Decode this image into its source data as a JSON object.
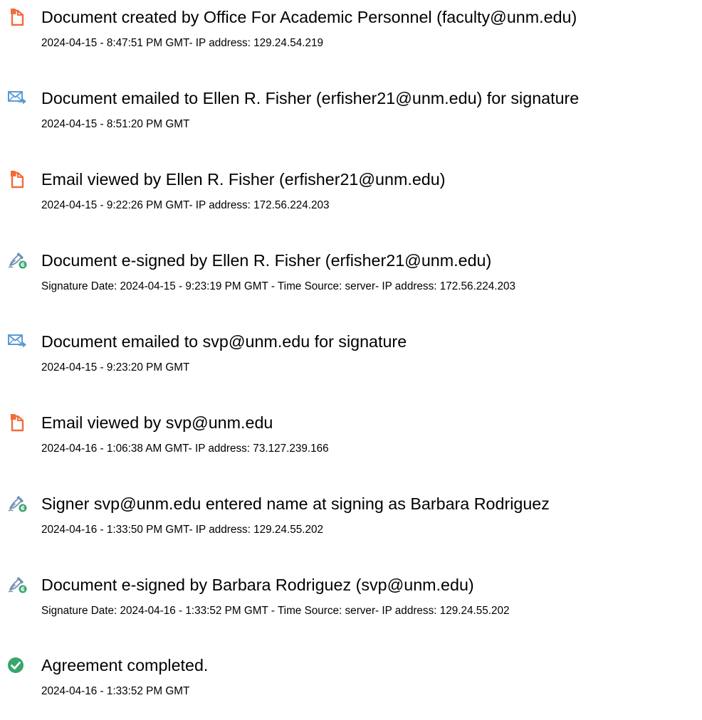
{
  "colors": {
    "document_icon": "#f26b3a",
    "email_icon": "#5a9bd5",
    "signature_icon": "#6f8fb3",
    "signature_badge": "#39a56c",
    "completed_badge": "#39a56c"
  },
  "events": [
    {
      "icon": "document-icon",
      "title": "Document created by Office For Academic Personnel (faculty@unm.edu)",
      "detail": "2024-04-15 - 8:47:51 PM GMT- IP address: 129.24.54.219"
    },
    {
      "icon": "email-icon",
      "title": "Document emailed to Ellen R. Fisher (erfisher21@unm.edu) for signature",
      "detail": "2024-04-15 - 8:51:20 PM GMT"
    },
    {
      "icon": "document-icon",
      "title": "Email viewed by Ellen R. Fisher (erfisher21@unm.edu)",
      "detail": "2024-04-15 - 9:22:26 PM GMT- IP address: 172.56.224.203"
    },
    {
      "icon": "signature-icon",
      "title": "Document e-signed by Ellen R. Fisher (erfisher21@unm.edu)",
      "detail": "Signature Date: 2024-04-15 - 9:23:19 PM GMT - Time Source: server- IP address: 172.56.224.203"
    },
    {
      "icon": "email-icon",
      "title": "Document emailed to svp@unm.edu for signature",
      "detail": "2024-04-15 - 9:23:20 PM GMT"
    },
    {
      "icon": "document-icon",
      "title": "Email viewed by svp@unm.edu",
      "detail": "2024-04-16 - 1:06:38 AM GMT- IP address: 73.127.239.166"
    },
    {
      "icon": "signature-icon",
      "title": "Signer svp@unm.edu entered name at signing as Barbara Rodriguez",
      "detail": "2024-04-16 - 1:33:50 PM GMT- IP address: 129.24.55.202"
    },
    {
      "icon": "signature-icon",
      "title": "Document e-signed by Barbara Rodriguez (svp@unm.edu)",
      "detail": "Signature Date: 2024-04-16 - 1:33:52 PM GMT - Time Source: server- IP address: 129.24.55.202"
    },
    {
      "icon": "checkmark-icon",
      "title": "Agreement completed.",
      "detail": "2024-04-16 - 1:33:52 PM GMT"
    }
  ]
}
